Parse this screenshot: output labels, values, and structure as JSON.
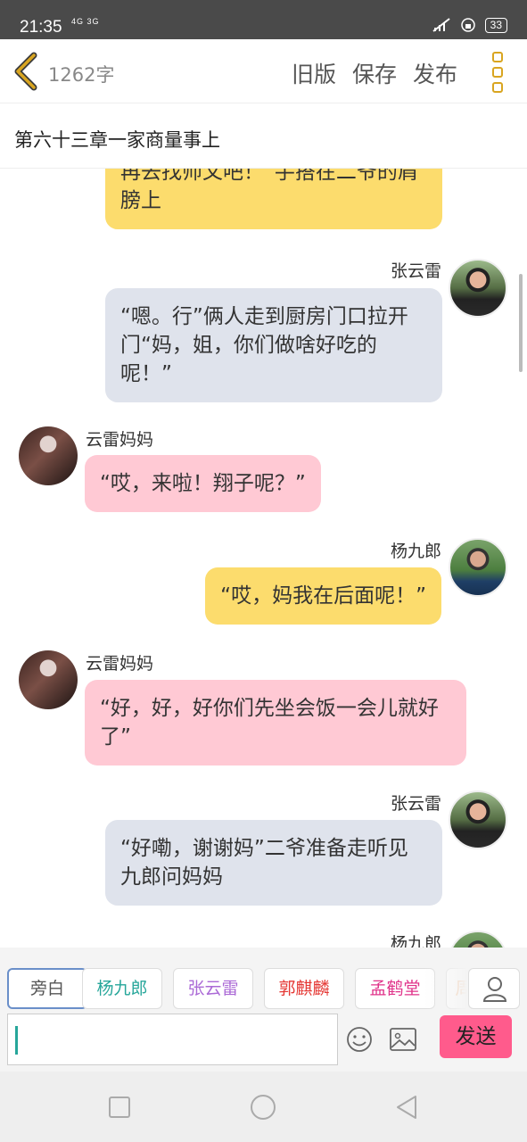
{
  "status_bar": {
    "time": "21:35",
    "network": "4G 3G",
    "battery": "33"
  },
  "header": {
    "word_count": "1262字",
    "actions": [
      "旧版",
      "保存",
      "发布"
    ]
  },
  "chapter_title": "第六十三章一家商量事上",
  "messages": [
    {
      "speaker": "",
      "text": "再去找师父吧！”手搭在二爷的肩膀上"
    },
    {
      "speaker": "张云雷",
      "text": "“嗯。行”俩人走到厨房门口拉开门“妈，姐，你们做啥好吃的呢！”"
    },
    {
      "speaker": "云雷妈妈",
      "text": "“哎，来啦！翔子呢？”"
    },
    {
      "speaker": "杨九郎",
      "text": "“哎，妈我在后面呢！”"
    },
    {
      "speaker": "云雷妈妈",
      "text": "“好，好，好你们先坐会饭一会儿就好了”"
    },
    {
      "speaker": "张云雷",
      "text": "“好嘞，谢谢妈”二爷准备走听见九郎问妈妈"
    },
    {
      "speaker": "杨九郎",
      "text": ""
    }
  ],
  "roles": [
    {
      "label": "旁白",
      "color": "#555555"
    },
    {
      "label": "杨九郎",
      "color": "#26a69a"
    },
    {
      "label": "张云雷",
      "color": "#ab6ad6"
    },
    {
      "label": "郭麒麟",
      "color": "#e53935"
    },
    {
      "label": "孟鹤堂",
      "color": "#e0338a"
    },
    {
      "label": "周",
      "color": "#f0a060"
    }
  ],
  "input": {
    "value": "",
    "send_label": "发送"
  },
  "icons": [
    "back-chevron-icon",
    "more-vertical-icon",
    "user-icon",
    "emoji-icon",
    "image-icon",
    "nav-square-icon",
    "nav-circle-icon",
    "nav-back-icon"
  ]
}
